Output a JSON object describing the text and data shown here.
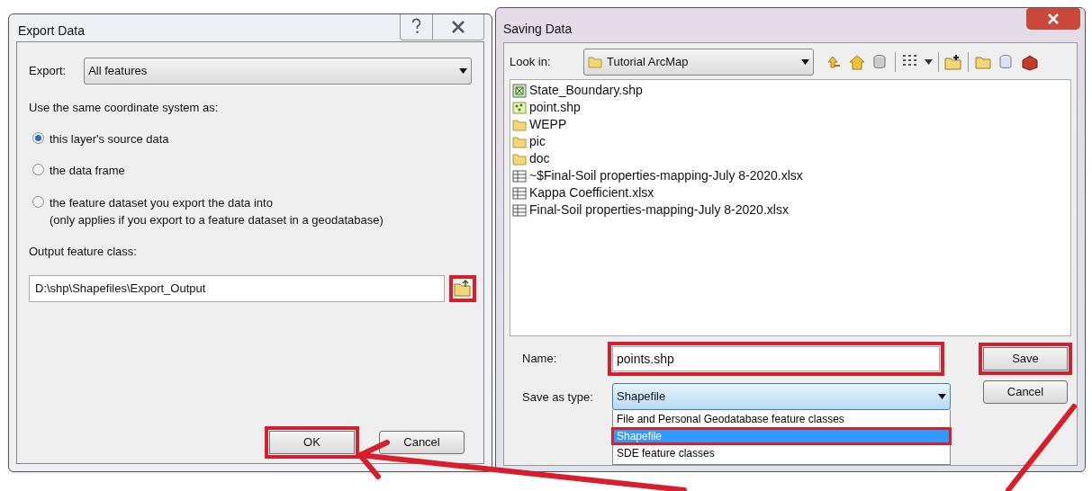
{
  "export_dialog": {
    "title": "Export Data",
    "export_label": "Export:",
    "export_value": "All features",
    "coordinate_label": "Use the same coordinate system as:",
    "radios": [
      {
        "label": "this layer's source data",
        "selected": true
      },
      {
        "label": "the data frame",
        "selected": false
      },
      {
        "label": "the feature dataset you export the data into",
        "note": "(only applies if you export to a feature dataset in a geodatabase)",
        "selected": false
      }
    ],
    "output_label": "Output feature class:",
    "output_value": "D:\\shp\\Shapefiles\\Export_Output",
    "browse_highlighted": true,
    "buttons": [
      {
        "label": "OK",
        "highlighted": true
      },
      {
        "label": "Cancel",
        "highlighted": false
      }
    ]
  },
  "saving_dialog": {
    "title": "Saving Data",
    "look_in_label": "Look in:",
    "look_in_value": "Tutorial ArcMap",
    "files": [
      {
        "name": "State_Boundary.shp",
        "kind": "polygon"
      },
      {
        "name": "point.shp",
        "kind": "point"
      },
      {
        "name": "WEPP",
        "kind": "folder"
      },
      {
        "name": "pic",
        "kind": "folder"
      },
      {
        "name": "doc",
        "kind": "folder"
      },
      {
        "name": "~$Final-Soil properties-mapping-July 8-2020.xlsx",
        "kind": "sheet"
      },
      {
        "name": "Kappa Coefficient.xlsx",
        "kind": "sheet"
      },
      {
        "name": "Final-Soil properties-mapping-July 8-2020.xlsx",
        "kind": "sheet"
      }
    ],
    "name_label": "Name:",
    "name_value": "points.shp",
    "name_highlighted": true,
    "type_label": "Save as type:",
    "type_value": "Shapefile",
    "type_options": [
      {
        "label": "File and Personal Geodatabase feature classes",
        "selected": false,
        "highlighted": false
      },
      {
        "label": "Shapefile",
        "selected": true,
        "highlighted": true
      },
      {
        "label": "SDE feature classes",
        "selected": false,
        "highlighted": false
      }
    ],
    "buttons": [
      {
        "label": "Save",
        "highlighted": true
      },
      {
        "label": "Cancel",
        "highlighted": false
      }
    ]
  }
}
